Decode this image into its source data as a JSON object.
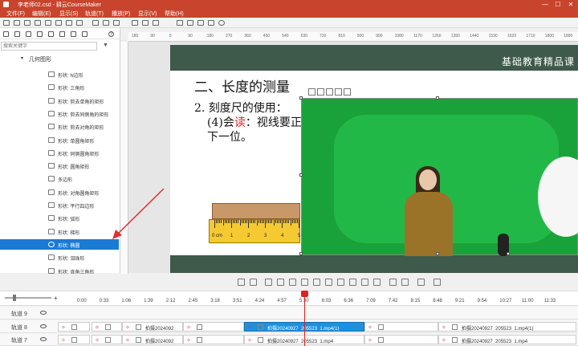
{
  "titlebar": {
    "title": "李老师02.csd - 耕云CourseMaker",
    "min": "—",
    "max": "☐",
    "close": "✕"
  },
  "menu": [
    "文件(F)",
    "编辑(E)",
    "显示(S)",
    "轨道(T)",
    "播放(P)",
    "显示(V)",
    "帮助(H)"
  ],
  "leftpanel": {
    "search_placeholder": "搜索关键字",
    "filter": "▼",
    "help": "?",
    "root": "几何图形",
    "items": [
      "形状: N边形",
      "形状: 三角形",
      "形状: 剪去单角的矩形",
      "形状: 剪去同侧角的矩形",
      "形状: 剪去对角的矩形",
      "形状: 单圆角矩形",
      "形状: 同侧圆角矩形",
      "形状: 圆角矩形",
      "多边形",
      "形状: 对角圆角矩形",
      "形状: 平行四边形",
      "形状: 弧形",
      "形状: 梯形",
      "形状: 椭圆",
      "形状: 泪珠形",
      "形状: 直角三角形"
    ],
    "selected_index": 13
  },
  "hruler_labels": [
    "180",
    "90",
    "0",
    "90",
    "180",
    "270",
    "360",
    "450",
    "540",
    "630",
    "720",
    "810",
    "900",
    "990",
    "1080",
    "1170",
    "1260",
    "1350",
    "1440",
    "1530",
    "1620",
    "1710",
    "1800",
    "1890"
  ],
  "slide": {
    "brand": "基础教育精品课",
    "heading": "二、长度的测量",
    "line1": "2. 刻度尺的使用：",
    "line2_prefix": "(4)会",
    "line2_red": "读",
    "line2_suffix": "：视线要正",
    "line3": "下一位。",
    "ruler_unit": "0 cm",
    "ruler_numbers": [
      "1",
      "2",
      "3",
      "4",
      "5"
    ]
  },
  "timeline": {
    "times": [
      "0:00",
      "0:33",
      "1:06",
      "1:39",
      "2:12",
      "2:45",
      "3:18",
      "3:51",
      "4:24",
      "4:57",
      "5:30",
      "6:03",
      "6:36",
      "7:09",
      "7:42",
      "8:15",
      "8:48",
      "9:21",
      "9:54",
      "10:27",
      "11:00",
      "11:33"
    ],
    "tracks": [
      {
        "name": "轨道 9",
        "clips": []
      },
      {
        "name": "轨道 8",
        "clips": [
          {
            "label": "",
            "active": false
          },
          {
            "label": "",
            "active": false
          },
          {
            "label": "拍摄2024092",
            "active": false
          },
          {
            "label": "",
            "active": false
          },
          {
            "label": "拍摄20240927_205523_1.mp4(1)",
            "active": true
          },
          {
            "label": "",
            "active": false
          },
          {
            "label": "拍摄20240927_205523_1.mp4(1)",
            "active": false
          }
        ]
      },
      {
        "name": "轨道 7",
        "clips": [
          {
            "label": "",
            "active": false
          },
          {
            "label": "",
            "active": false
          },
          {
            "label": "拍摄2024092",
            "active": false
          },
          {
            "label": "",
            "active": false
          },
          {
            "label": "拍摄20240927_205523_1.mp4",
            "active": false
          },
          {
            "label": "",
            "active": false
          },
          {
            "label": "拍摄20240927_205523_1.mp4",
            "active": false
          }
        ]
      }
    ]
  }
}
